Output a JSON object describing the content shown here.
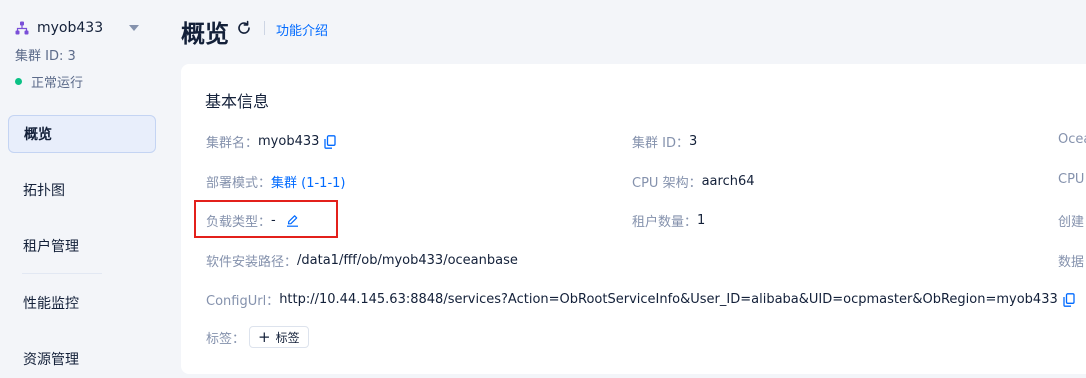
{
  "sidebar": {
    "cluster_name": "myob433",
    "cluster_id": "集群 ID: 3",
    "status": "正常运行",
    "status_color": "#0ac185",
    "items": [
      {
        "label": "概览",
        "active": true
      },
      {
        "label": "拓扑图",
        "active": false
      },
      {
        "label": "租户管理",
        "active": false
      },
      {
        "label": "性能监控",
        "active": false
      },
      {
        "label": "资源管理",
        "active": false
      }
    ]
  },
  "header": {
    "title": "概览",
    "intro_link": "功能介绍"
  },
  "basic_info": {
    "title": "基本信息",
    "cluster_name_label": "集群名：",
    "cluster_name_value": "myob433",
    "deploy_mode_label": "部署模式：",
    "deploy_mode_value": "集群 (1-1-1)",
    "load_type_label": "负载类型：",
    "load_type_value": "-",
    "install_path_label": "软件安装路径：",
    "install_path_value": "/data1/fff/ob/myob433/oceanbase",
    "config_url_label": "ConfigUrl：",
    "config_url_value": "http://10.44.145.63:8848/services?Action=ObRootServiceInfo&User_ID=alibaba&UID=ocpmaster&ObRegion=myob433",
    "tags_label": "标签：",
    "add_tag_label": "标签",
    "cluster_id_label": "集群 ID：",
    "cluster_id_value": "3",
    "cpu_arch_label": "CPU 架构：",
    "cpu_arch_value": "aarch64",
    "tenant_count_label": "租户数量：",
    "tenant_count_value": "1",
    "col3": [
      "Ocea",
      "CPU",
      "创建",
      "数据"
    ]
  },
  "colors": {
    "accent": "#006aff",
    "highlight": "#e3201b"
  }
}
